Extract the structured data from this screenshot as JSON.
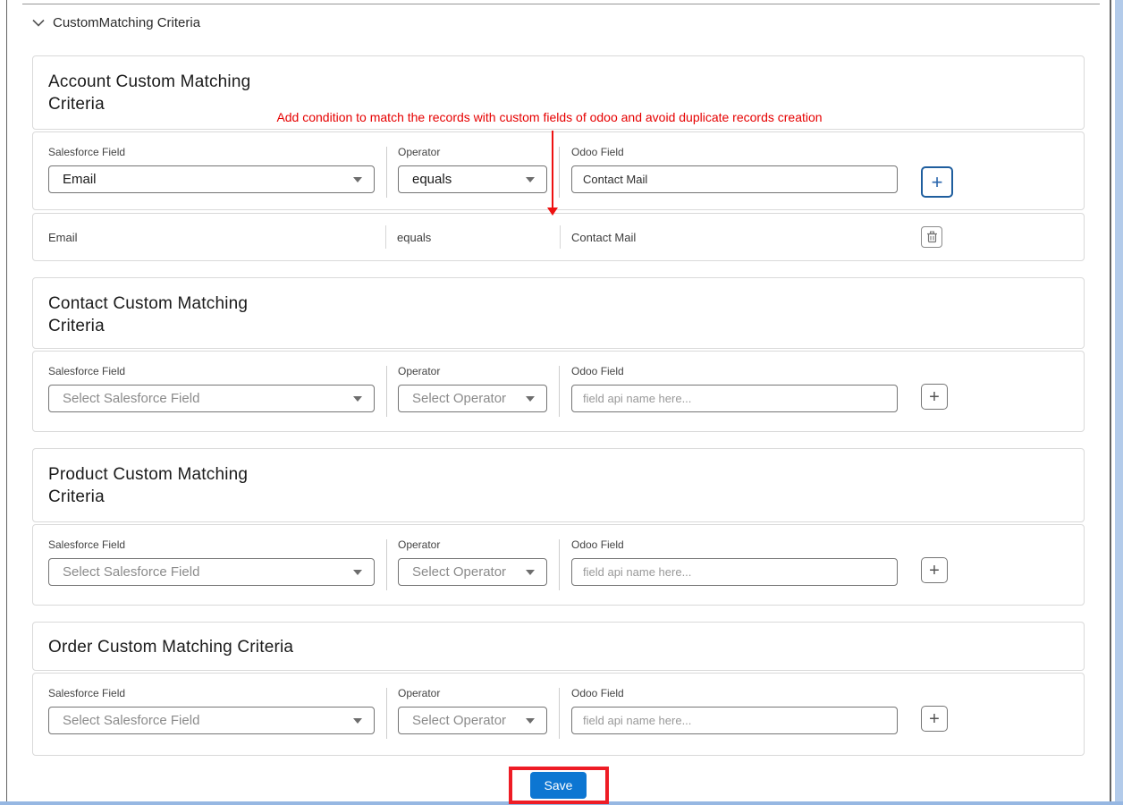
{
  "header": {
    "title": "CustomMatching Criteria"
  },
  "annotation": {
    "text": "Add condition to match the records with custom fields of odoo and avoid duplicate records creation"
  },
  "labels": {
    "salesforce_field": "Salesforce Field",
    "operator": "Operator",
    "odoo_field": "Odoo Field"
  },
  "placeholders": {
    "salesforce_field": "Select Salesforce Field",
    "operator": "Select Operator",
    "odoo_field": "field api name here..."
  },
  "sections": [
    {
      "title": "Account Custom Matching\nCriteria",
      "row": {
        "salesforce_value": "Email",
        "operator_value": "equals",
        "odoo_value": "Contact Mail"
      },
      "saved": {
        "salesforce": "Email",
        "operator": "equals",
        "odoo": "Contact Mail"
      }
    },
    {
      "title": "Contact Custom Matching\nCriteria"
    },
    {
      "title": "Product Custom Matching\nCriteria"
    },
    {
      "title": "Order Custom Matching Criteria"
    }
  ],
  "buttons": {
    "add": "+",
    "save": "Save"
  },
  "colors": {
    "annotation_red": "#e60000",
    "highlight_red": "#ee1c25",
    "save_blue": "#0d76d2",
    "focus_blue": "#1f5e9e"
  }
}
